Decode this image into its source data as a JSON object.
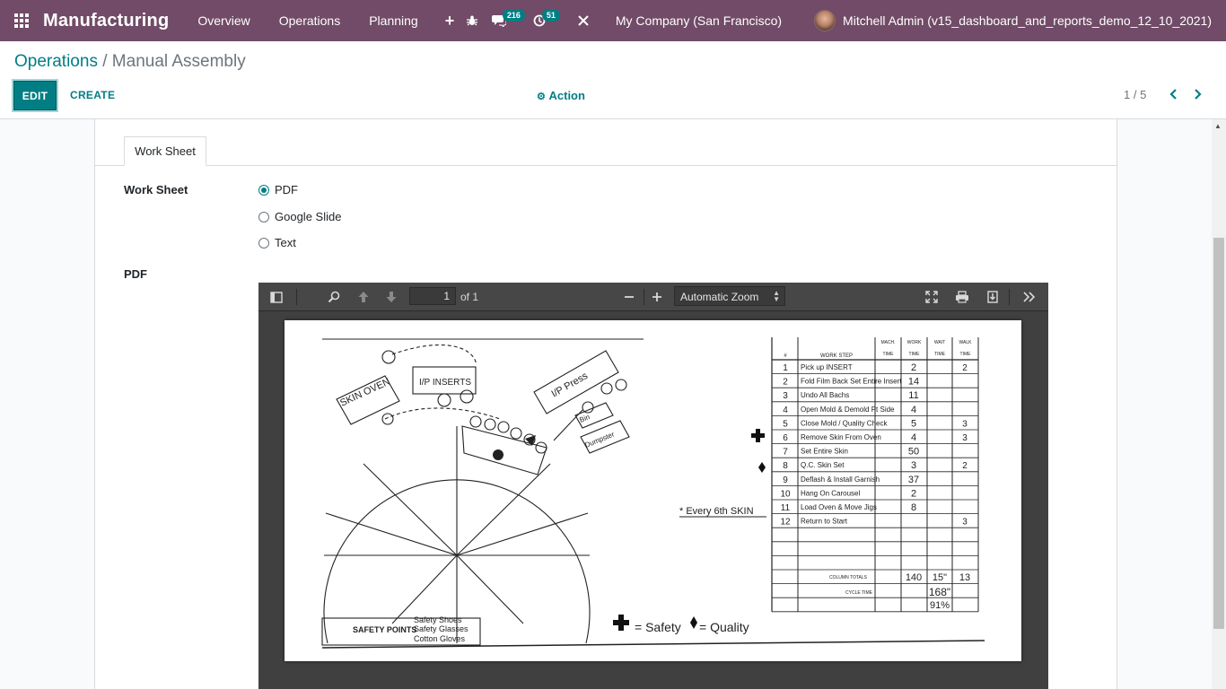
{
  "navbar": {
    "app_name": "Manufacturing",
    "menu": [
      "Overview",
      "Operations",
      "Planning"
    ],
    "plus": "+",
    "messages_count": "216",
    "activities_count": "51",
    "company": "My Company (San Francisco)",
    "user": "Mitchell Admin (v15_dashboard_and_reports_demo_12_10_2021)",
    "accent_color": "#714B67"
  },
  "breadcrumb": {
    "parent": "Operations",
    "separator": " / ",
    "current": "Manual Assembly"
  },
  "buttons": {
    "edit": "EDIT",
    "create": "CREATE",
    "action": "Action"
  },
  "pager": {
    "value": "1 / 5"
  },
  "form": {
    "tab": "Work Sheet",
    "worksheet_label": "Work Sheet",
    "options": [
      "PDF",
      "Google Slide",
      "Text"
    ],
    "selected": "PDF",
    "pdf_label": "PDF"
  },
  "pdf_viewer": {
    "page": "1",
    "of_pages": "of 1",
    "zoom": "Automatic Zoom",
    "icons": [
      "sidebar-toggle-icon",
      "search-icon",
      "previous-page-icon",
      "next-page-icon",
      "zoom-out-icon",
      "zoom-in-icon",
      "presentation-mode-icon",
      "print-icon",
      "download-icon",
      "tools-icon"
    ]
  },
  "document": {
    "skin_oven": "SKIN OVEN",
    "ip_inserts": "I/P INSERTS",
    "ip_press": "I/P Press",
    "dumpster": "Dumpster",
    "bin": "Bin",
    "every_skin": "* Every 6th SKIN",
    "safety_points": "SAFETY POINTS",
    "safety_items": [
      "Safety Shoes",
      "Safety Glasses",
      "Cotton Gloves"
    ],
    "legend_safety": "= Safety",
    "legend_quality": "= Quality",
    "table_headers": [
      "#",
      "WORK STEP",
      "MACH. TIME",
      "WORK TIME",
      "WAIT TIME",
      "WALK TIME"
    ],
    "steps": [
      {
        "n": "1",
        "step": "Pick up INSERT",
        "work": "2",
        "walk": "2"
      },
      {
        "n": "2",
        "step": "Fold Film Back Set Entire Insert",
        "work": "14",
        "walk": ""
      },
      {
        "n": "3",
        "step": "Undo All Bachs",
        "work": "11",
        "walk": ""
      },
      {
        "n": "4",
        "step": "Open Mold & Demold Pt Side",
        "work": "4",
        "walk": ""
      },
      {
        "n": "5",
        "step": "Close Mold / Quality Check",
        "work": "5",
        "walk": "3"
      },
      {
        "n": "6",
        "step": "Remove Skin From Oven",
        "work": "4",
        "walk": "3"
      },
      {
        "n": "7",
        "step": "Set Entire Skin",
        "work": "50",
        "walk": ""
      },
      {
        "n": "8",
        "step": "Q.C. Skin Set",
        "work": "3",
        "walk": "2"
      },
      {
        "n": "9",
        "step": "Deflash & Install Garnish",
        "work": "37",
        "walk": ""
      },
      {
        "n": "10",
        "step": "Hang On Carousel",
        "work": "2",
        "walk": ""
      },
      {
        "n": "11",
        "step": "Load Oven & Move Jigs",
        "work": "8",
        "walk": ""
      },
      {
        "n": "12",
        "step": "Return to Start",
        "work": "",
        "walk": "3"
      }
    ],
    "column_totals_label": "COLUMN TOTALS",
    "totals": {
      "work": "140",
      "wait": "15\"",
      "walk": "13"
    },
    "cycle_time_label": "CYCLE TIME",
    "cycle_time": "168\"",
    "cycle_pct": "91%"
  }
}
